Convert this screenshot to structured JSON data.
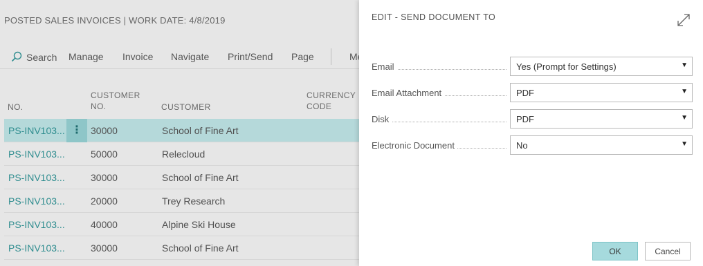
{
  "background": {
    "page_title": "POSTED SALES INVOICES | WORK DATE: 4/8/2019",
    "actions": [
      "Search",
      "Manage",
      "Invoice",
      "Navigate",
      "Print/Send",
      "Page",
      "Me"
    ],
    "columns": {
      "no": "NO.",
      "customer_no_1": "CUSTOMER",
      "customer_no_2": "NO.",
      "customer": "CUSTOMER",
      "currency_1": "CURRENCY",
      "currency_2": "CODE"
    },
    "rows": [
      {
        "no": "PS-INV103...",
        "customer_no": "30000",
        "customer": "School of Fine Art"
      },
      {
        "no": "PS-INV103...",
        "customer_no": "50000",
        "customer": "Relecloud"
      },
      {
        "no": "PS-INV103...",
        "customer_no": "30000",
        "customer": "School of Fine Art"
      },
      {
        "no": "PS-INV103...",
        "customer_no": "20000",
        "customer": "Trey Research"
      },
      {
        "no": "PS-INV103...",
        "customer_no": "40000",
        "customer": "Alpine Ski House"
      },
      {
        "no": "PS-INV103...",
        "customer_no": "30000",
        "customer": "School of Fine Art"
      }
    ],
    "row_menu_glyph": "⋮"
  },
  "dialog": {
    "title": "EDIT - SEND DOCUMENT TO",
    "fields": [
      {
        "label": "Email",
        "value": "Yes (Prompt for Settings)"
      },
      {
        "label": "Email Attachment",
        "value": "PDF"
      },
      {
        "label": "Disk",
        "value": "PDF"
      },
      {
        "label": "Electronic Document",
        "value": "No"
      }
    ],
    "ok_label": "OK",
    "cancel_label": "Cancel",
    "caret": "▼"
  },
  "colors": {
    "accent": "#2f8d8f",
    "selected_row": "#b5d9da",
    "ok_button": "#a6dadd"
  }
}
